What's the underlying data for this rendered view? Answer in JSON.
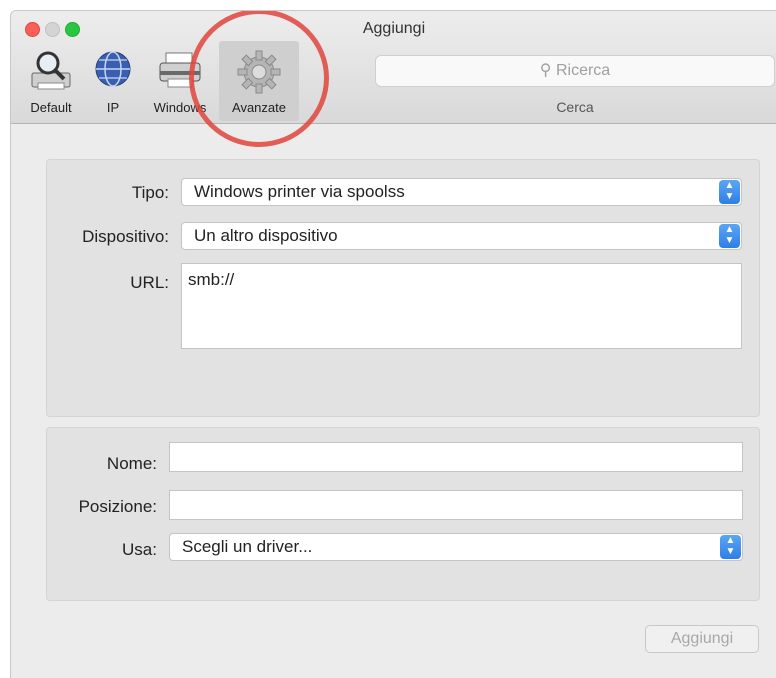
{
  "window": {
    "title": "Aggiungi"
  },
  "toolbar": {
    "tools": [
      {
        "label": "Default",
        "icon": "magnifier-printer-icon"
      },
      {
        "label": "IP",
        "icon": "globe-icon"
      },
      {
        "label": "Windows",
        "icon": "printer-icon"
      },
      {
        "label": "Avanzate",
        "icon": "gear-icon",
        "selected": true
      }
    ]
  },
  "search": {
    "placeholder": "Ricerca",
    "label": "Cerca"
  },
  "form": {
    "tipo": {
      "label": "Tipo:",
      "value": "Windows printer via spoolss"
    },
    "dispositivo": {
      "label": "Dispositivo:",
      "value": "Un altro dispositivo"
    },
    "url": {
      "label": "URL:",
      "value": "smb://"
    },
    "nome": {
      "label": "Nome:",
      "value": ""
    },
    "posizione": {
      "label": "Posizione:",
      "value": ""
    },
    "usa": {
      "label": "Usa:",
      "value": "Scegli un driver..."
    }
  },
  "add_button": {
    "label": "Aggiungi"
  },
  "colors": {
    "accent": "#2f7ee6",
    "callout": "#e0443c"
  }
}
